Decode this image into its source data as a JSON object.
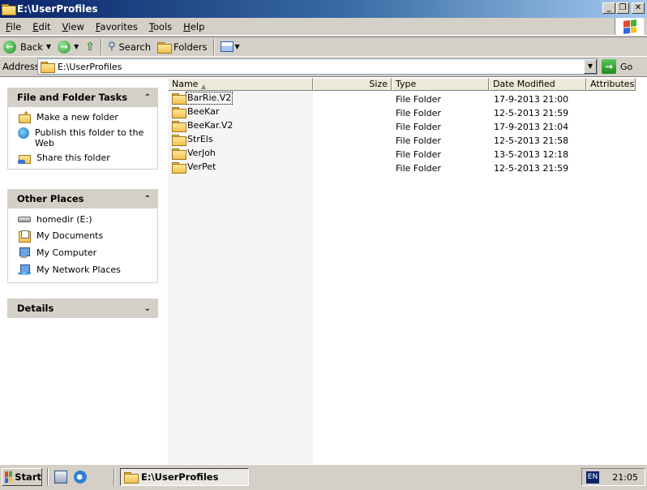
{
  "window": {
    "title": "E:\\UserProfiles",
    "buttons": {
      "minimize": "_",
      "maximize": "❐",
      "close": "✕"
    }
  },
  "menu": [
    "File",
    "Edit",
    "View",
    "Favorites",
    "Tools",
    "Help"
  ],
  "toolbar": {
    "back_label": "Back",
    "search_label": "Search",
    "folders_label": "Folders"
  },
  "address": {
    "label": "Address",
    "path": "E:\\UserProfiles",
    "go_label": "Go"
  },
  "tasks_panel": {
    "title": "File and Folder Tasks",
    "items": [
      "Make a new folder",
      "Publish this folder to the Web",
      "Share this folder"
    ]
  },
  "places_panel": {
    "title": "Other Places",
    "items": [
      "homedir (E:)",
      "My Documents",
      "My Computer",
      "My Network Places"
    ]
  },
  "details_panel": {
    "title": "Details"
  },
  "columns": {
    "name": "Name",
    "size": "Size",
    "type": "Type",
    "modified": "Date Modified",
    "attributes": "Attributes"
  },
  "files": [
    {
      "name": "BarRie.V2",
      "type": "File Folder",
      "modified": "17-9-2013 21:00"
    },
    {
      "name": "BeeKar",
      "type": "File Folder",
      "modified": "12-5-2013 21:59"
    },
    {
      "name": "BeeKar.V2",
      "type": "File Folder",
      "modified": "17-9-2013 21:04"
    },
    {
      "name": "StrEls",
      "type": "File Folder",
      "modified": "12-5-2013 21:58"
    },
    {
      "name": "VerJoh",
      "type": "File Folder",
      "modified": "13-5-2013 12:18"
    },
    {
      "name": "VerPet",
      "type": "File Folder",
      "modified": "12-5-2013 21:59"
    }
  ],
  "taskbar": {
    "start_label": "Start",
    "task_label": "E:\\UserProfiles",
    "language": "EN",
    "clock": "21:05"
  }
}
